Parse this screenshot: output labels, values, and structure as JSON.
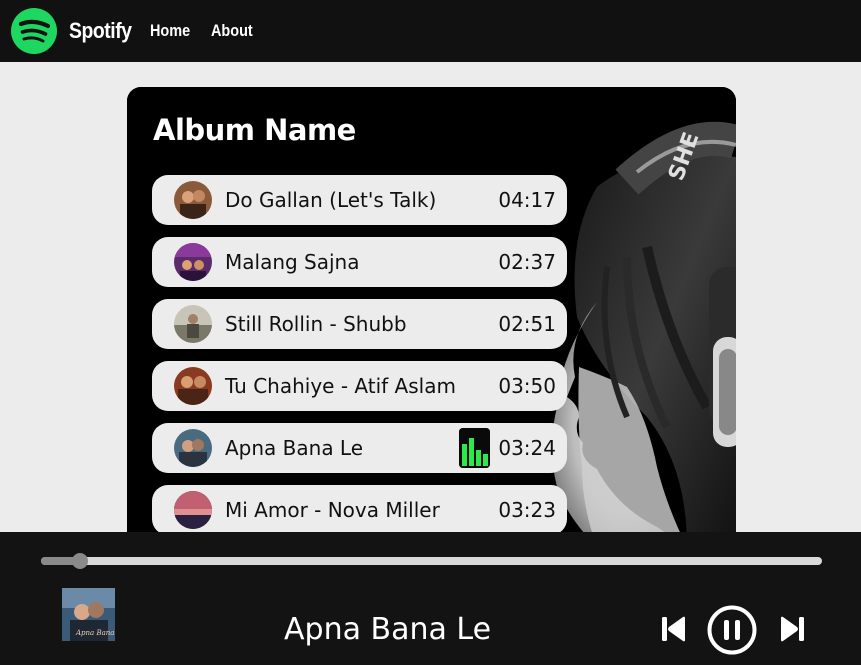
{
  "navbar": {
    "brand": "Spotify",
    "links": [
      "Home",
      "About"
    ],
    "logo_icon": "spotify-logo-icon"
  },
  "colors": {
    "navbar_bg": "#111111",
    "page_bg": "#ececec",
    "card_bg": "#000000",
    "song_item_bg": "#ececec",
    "spotify_green": "#1ed760",
    "player_bg": "#131313"
  },
  "album": {
    "title": "Album Name",
    "songs": [
      {
        "name": "Do Gallan (Let's Talk)",
        "duration": "04:17"
      },
      {
        "name": "Malang Sajna",
        "duration": "02:37"
      },
      {
        "name": "Still Rollin - Shubb",
        "duration": "02:51"
      },
      {
        "name": "Tu Chahiye - Atif Aslam",
        "duration": "03:50"
      },
      {
        "name": "Apna Bana Le",
        "duration": "03:24",
        "playing": true
      },
      {
        "name": "Mi Amor - Nova Miller",
        "duration": "03:23"
      }
    ]
  },
  "player": {
    "now_playing": "Apna Bana Le",
    "progress": 0.05,
    "icons": [
      "previous-icon",
      "pause-icon",
      "next-icon"
    ]
  }
}
